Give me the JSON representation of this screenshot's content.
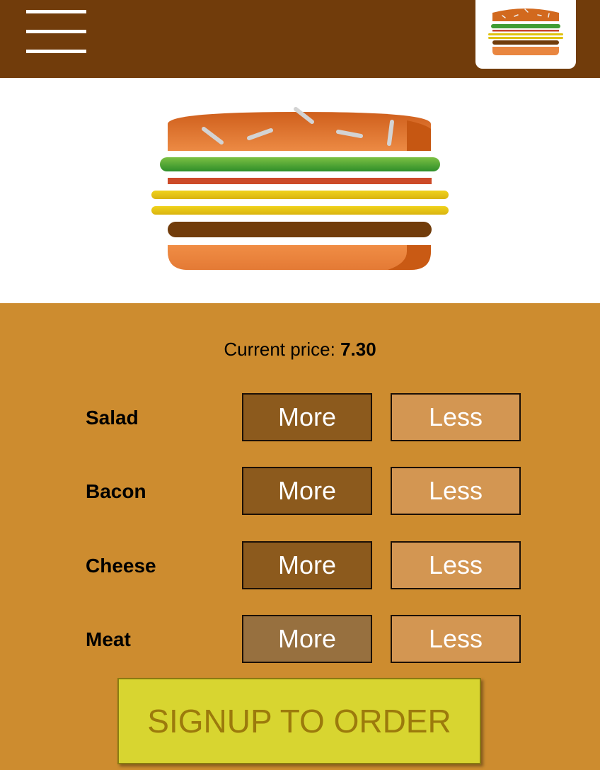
{
  "colors": {
    "topbar": "#713c0b",
    "build_panel": "#cd8c2f",
    "more_button": "#8c5a1d",
    "more_button_disabled": "#97703f",
    "less_button": "#d39652",
    "signup_button": "#d8d530",
    "signup_text": "#9c7a0c"
  },
  "header": {
    "menu_icon": "hamburger-icon",
    "logo_icon": "burger-logo-icon"
  },
  "preview": {
    "icon": "burger-preview-icon"
  },
  "price": {
    "label": "Current price: ",
    "value": "7.30"
  },
  "controls": [
    {
      "label": "Salad",
      "more": "More",
      "less": "Less",
      "more_disabled": false
    },
    {
      "label": "Bacon",
      "more": "More",
      "less": "Less",
      "more_disabled": false
    },
    {
      "label": "Cheese",
      "more": "More",
      "less": "Less",
      "more_disabled": false
    },
    {
      "label": "Meat",
      "more": "More",
      "less": "Less",
      "more_disabled": true
    }
  ],
  "signup": {
    "label": "SIGNUP TO ORDER"
  }
}
